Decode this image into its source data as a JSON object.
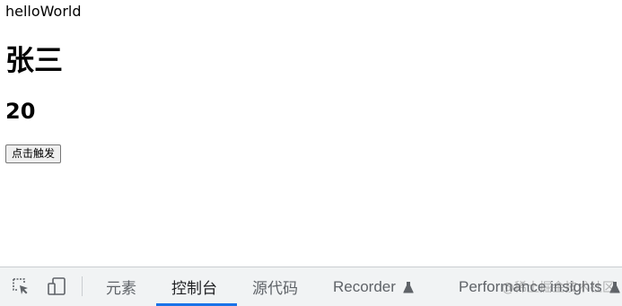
{
  "page": {
    "hello_text": "helloWorld",
    "name": "张三",
    "age": "20",
    "button_label": "点击触发"
  },
  "devtools": {
    "inspect_icon": "inspect-element-icon",
    "device_icon": "device-toolbar-icon",
    "tabs": [
      {
        "label": "元素",
        "active": false
      },
      {
        "label": "控制台",
        "active": true
      },
      {
        "label": "源代码",
        "active": false
      },
      {
        "label": "Recorder",
        "active": false,
        "icon": "flask-icon"
      },
      {
        "label": "Performance insights",
        "active": false,
        "icon": "flask-icon"
      }
    ],
    "accent_color": "#1a73e8",
    "watermark": "@稀土掘金技术社区"
  }
}
